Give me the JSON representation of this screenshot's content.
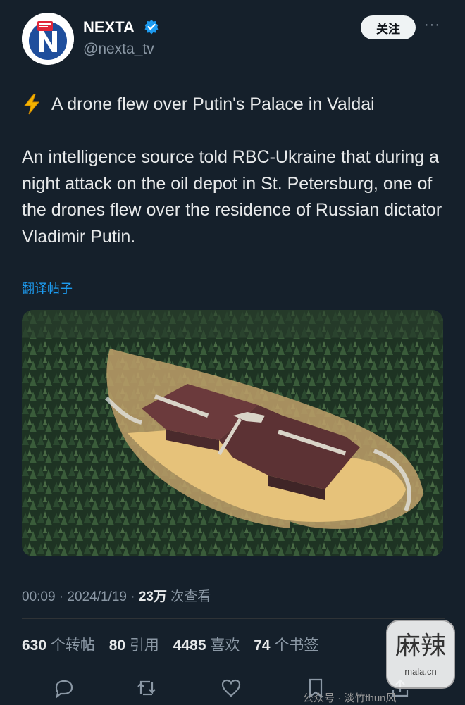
{
  "account": {
    "name": "NEXTA",
    "handle": "@nexta_tv",
    "follow_label": "关注",
    "more_label": "···"
  },
  "post": {
    "headline": "A drone flew over Putin's Palace in Valdai",
    "body": "An intelligence source told RBC-Ukraine that during a night attack on the oil depot in St. Petersburg, one of the drones flew over the residence of Russian dictator Vladimir Putin.",
    "translate_label": "翻译帖子",
    "time": "00:09 · 2024/1/19 · ",
    "views_count": "23万",
    "views_label": " 次查看"
  },
  "stats": [
    {
      "count": "630",
      "label": "个转帖"
    },
    {
      "count": "80",
      "label": "引用"
    },
    {
      "count": "4485",
      "label": "喜欢"
    },
    {
      "count": "74",
      "label": "个书签"
    }
  ],
  "watermark": {
    "big": "麻辣",
    "small": "mala.cn",
    "gzh": "公众号 · 淡竹thun风"
  },
  "colors": {
    "background": "#15202b",
    "link": "#1d9bf0",
    "verified": "#1d9bf0",
    "muted": "#8b98a5"
  },
  "icons": [
    "verified-badge-icon",
    "lightning-icon",
    "reply-icon",
    "retweet-icon",
    "like-icon",
    "bookmark-icon",
    "share-icon"
  ]
}
